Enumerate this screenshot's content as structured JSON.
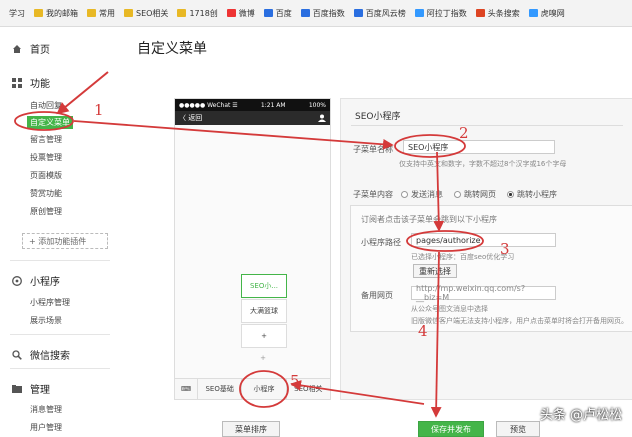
{
  "bookmarks": [
    {
      "label": "学习",
      "icon": "none"
    },
    {
      "label": "我的邮箱",
      "icon": "folder-icon"
    },
    {
      "label": "常用",
      "icon": "folder-icon"
    },
    {
      "label": "SEO相关",
      "icon": "folder-icon"
    },
    {
      "label": "1718创",
      "icon": "folder-icon"
    },
    {
      "label": "微博",
      "icon": "weibo-icon"
    },
    {
      "label": "百度",
      "icon": "baidu-paw-icon"
    },
    {
      "label": "百度指数",
      "icon": "baidu-paw-icon"
    },
    {
      "label": "百度风云榜",
      "icon": "baidu-paw-icon"
    },
    {
      "label": "阿拉丁指数",
      "icon": "tool-icon"
    },
    {
      "label": "头条搜索",
      "icon": "toutiao-icon"
    },
    {
      "label": "虎嗅网",
      "icon": "web-icon"
    }
  ],
  "sidebar": {
    "home": "首页",
    "features": "功能",
    "feature_items": [
      "自动回复",
      "自定义菜单",
      "留言管理",
      "投票管理",
      "页面模版",
      "赞赏功能",
      "原创管理"
    ],
    "add_plugin": "+ 添加功能插件",
    "miniprogram": "小程序",
    "mini_items": [
      "小程序管理",
      "展示场景"
    ],
    "wechat_search": "微信搜索",
    "manage": "管理",
    "manage_items": [
      "消息管理",
      "用户管理"
    ]
  },
  "page_title": "自定义菜单",
  "phone": {
    "carrier": "●●●●● WeChat ☰",
    "time": "1:21 AM",
    "battery": "100%",
    "back": "〈 返回",
    "submenu_items": [
      "SEO小...",
      "大满篮球"
    ],
    "submenu_add": "+",
    "menu_add": "+",
    "menu_items": [
      "SEO基础",
      "小程序",
      "SEO相关"
    ]
  },
  "editor": {
    "header": "SEO小程序",
    "name_label": "子菜单名称",
    "name_value": "SEO小程序",
    "name_hint": "仅支持中英文和数字，字数不超过8个汉字或16个字母",
    "content_label": "子菜单内容",
    "content_options": [
      "发送消息",
      "跳转网页",
      "跳转小程序"
    ],
    "selected_option_index": 2,
    "box_hint": "订阅者点击该子菜单会跳到以下小程序",
    "path_label": "小程序路径",
    "path_value": "pages/authorize",
    "path_selected": "已选择小程序：百度seo优化学习",
    "reselect": "重新选择",
    "backup_label": "备用网页",
    "backup_value": "http://mp.weixin.qq.com/s?__biz=M",
    "backup_hint1": "从公众号图文消息中选择",
    "backup_hint2": "旧版微信客户端无法支持小程序，用户点击菜单时将会打开备用网页。"
  },
  "buttons": {
    "sort": "菜单排序",
    "save": "保存并发布",
    "preview": "预览"
  },
  "annotations": [
    "1",
    "2",
    "3",
    "4",
    "5"
  ],
  "watermark": "头条 @卢松松",
  "colors": {
    "accent": "#44b549",
    "annotation": "#d43a3a"
  }
}
